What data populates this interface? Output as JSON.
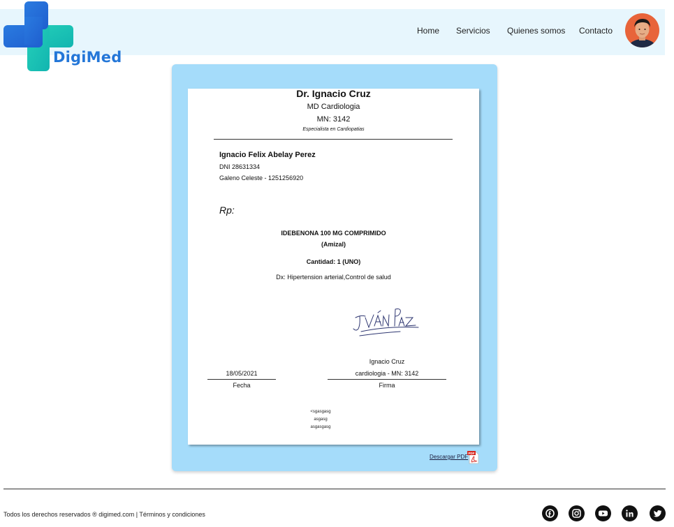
{
  "brand": {
    "name": "DigiMed"
  },
  "nav": {
    "home": "Home",
    "services": "Servicios",
    "about": "Quienes somos",
    "contact": "Contacto"
  },
  "prescription": {
    "doctor_name": "Dr. Ignacio Cruz",
    "doctor_specialty": "MD Cardiologia",
    "doctor_mn": "MN: 3142",
    "doctor_expertise": "Especialista en Cardiopatias",
    "patient_name": "Ignacio Felix Abelay Perez",
    "patient_dni": "DNI 28631334",
    "patient_insurance": "Galeno Celeste - 1251256920",
    "rp_label": "Rp:",
    "medication_name": "IDEBENONA 100 MG COMPRIMIDO",
    "medication_brand": "(Amizal)",
    "quantity": "Cantidad: 1 (UNO)",
    "diagnosis": "Dx: Hipertension arterial,Control de salud",
    "signer_name": "Ignacio Cruz",
    "signer_mn": "cardiologia - MN: 3142",
    "signature_label": "Firma",
    "date_value": "18/05/2021",
    "date_label": "Fecha",
    "note_line1": "<sgasgasg",
    "note_line2": "asgasg",
    "note_line3": "asgasgasg",
    "signature_script": "Iván Paz"
  },
  "download": {
    "label": "Descargar PDF",
    "icon_badge": "PDF"
  },
  "footer": {
    "text": "Todos los derechos reservados ® digimed.com  | Términos y condiciones",
    "social": [
      "facebook-icon",
      "instagram-icon",
      "youtube-icon",
      "linkedin-icon",
      "twitter-icon"
    ]
  },
  "colors": {
    "header_bg": "#e7f6fd",
    "card_bg": "#a5dcfa",
    "brand_blue": "#2477d8",
    "brand_teal": "#17c3b2"
  }
}
